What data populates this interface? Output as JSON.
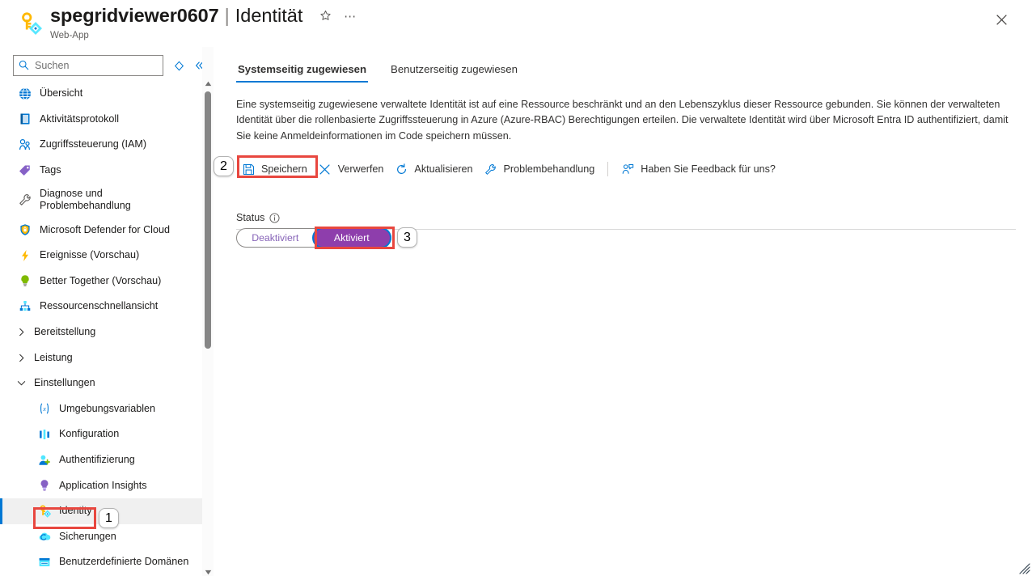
{
  "header": {
    "resource_name": "spegridviewer0607",
    "separator": "|",
    "page_name": "Identität",
    "subtitle": "Web-App",
    "favorite_icon": "star-icon",
    "more_icon": "ellipsis-icon",
    "close_icon": "close-icon",
    "resource_icon": "managed-identity-key-icon"
  },
  "sidebar": {
    "search": {
      "placeholder": "Suchen",
      "value": "",
      "icon": "search-icon"
    },
    "pin_icon": "pin-icon",
    "collapse_icon": "double-chevron-left-icon",
    "items": [
      {
        "label": "Übersicht",
        "icon": "overview-globe-icon",
        "type": "item"
      },
      {
        "label": "Aktivitätsprotokoll",
        "icon": "activity-log-icon",
        "type": "item"
      },
      {
        "label": "Zugriffssteuerung (IAM)",
        "icon": "access-control-people-icon",
        "type": "item"
      },
      {
        "label": "Tags",
        "icon": "tags-icon",
        "type": "item"
      },
      {
        "label": "Diagnose und Problembehandlung",
        "icon": "wrench-icon",
        "type": "item-tall"
      },
      {
        "label": "Microsoft Defender for Cloud",
        "icon": "shield-icon",
        "type": "item"
      },
      {
        "label": "Ereignisse (Vorschau)",
        "icon": "lightning-icon",
        "type": "item"
      },
      {
        "label": "Better Together (Vorschau)",
        "icon": "lightbulb-icon",
        "type": "item"
      },
      {
        "label": "Ressourcenschnellansicht",
        "icon": "resource-graph-icon",
        "type": "item"
      },
      {
        "label": "Bereitstellung",
        "icon": "chevron-right-icon",
        "type": "group-collapsed"
      },
      {
        "label": "Leistung",
        "icon": "chevron-right-icon",
        "type": "group-collapsed"
      },
      {
        "label": "Einstellungen",
        "icon": "chevron-down-icon",
        "type": "group-expanded"
      },
      {
        "label": "Umgebungsvariablen",
        "icon": "variables-icon",
        "type": "sub"
      },
      {
        "label": "Konfiguration",
        "icon": "configuration-icon",
        "type": "sub"
      },
      {
        "label": "Authentifizierung",
        "icon": "authentication-user-icon",
        "type": "sub"
      },
      {
        "label": "Application Insights",
        "icon": "application-insights-icon",
        "type": "sub"
      },
      {
        "label": "Identity",
        "icon": "identity-key-icon",
        "type": "sub",
        "active": true
      },
      {
        "label": "Sicherungen",
        "icon": "backups-cloud-icon",
        "type": "sub"
      },
      {
        "label": "Benutzerdefinierte Domänen",
        "icon": "custom-domains-icon",
        "type": "sub"
      }
    ],
    "scrollbar": {
      "up_icon": "scroll-up-arrow-icon",
      "down_icon": "scroll-down-arrow-icon"
    }
  },
  "main": {
    "tabs": [
      {
        "label": "Systemseitig zugewiesen",
        "active": true
      },
      {
        "label": "Benutzerseitig zugewiesen",
        "active": false
      }
    ],
    "description": "Eine systemseitig zugewiesene verwaltete Identität ist auf eine Ressource beschränkt und an den Lebenszyklus dieser Ressource gebunden. Sie können der verwalteten Identität über die rollenbasierte Zugriffssteuerung in Azure (Azure-RBAC) Berechtigungen erteilen. Die verwaltete Identität wird über Microsoft Entra ID authentifiziert, damit Sie keine Anmeldeinformationen im Code speichern müssen.",
    "toolbar": [
      {
        "label": "Speichern",
        "icon": "save-disk-icon"
      },
      {
        "label": "Verwerfen",
        "icon": "discard-x-icon"
      },
      {
        "label": "Aktualisieren",
        "icon": "refresh-icon"
      },
      {
        "label": "Problembehandlung",
        "icon": "wrench-icon"
      },
      {
        "label": "Haben Sie Feedback für uns?",
        "icon": "feedback-person-icon"
      }
    ],
    "status": {
      "label": "Status",
      "info_icon": "info-icon",
      "options": [
        {
          "label": "Deaktiviert",
          "selected": false
        },
        {
          "label": "Aktiviert",
          "selected": true
        }
      ]
    }
  },
  "annotations": {
    "steps": [
      {
        "number": "1",
        "target": "sidebar-item-identity"
      },
      {
        "number": "2",
        "target": "save-button"
      },
      {
        "number": "3",
        "target": "status-toggle-aktiviert"
      }
    ],
    "highlight_color": "#e8473f"
  },
  "colors": {
    "accent": "#0078d4",
    "toggle_on_fill": "#8e3eac",
    "toggle_text": "#8764b8",
    "highlight": "#e8473f",
    "active_nav_bg": "#f0f0f0"
  }
}
